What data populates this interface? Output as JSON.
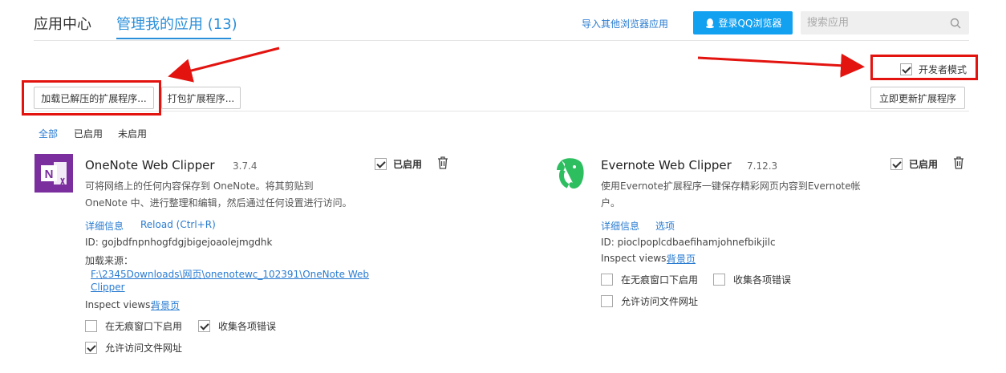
{
  "header": {
    "tab_app_center": "应用中心",
    "tab_manage": "管理我的应用 (13)",
    "import_link": "导入其他浏览器应用",
    "login_button": "登录QQ浏览器",
    "search_placeholder": "搜索应用"
  },
  "toolbar": {
    "load_unpacked": "加载已解压的扩展程序...",
    "pack_extension": "打包扩展程序...",
    "developer_mode_label": "开发者模式",
    "developer_mode_checked": true,
    "update_now": "立即更新扩展程序"
  },
  "filters": [
    "全部",
    "已启用",
    "未启用"
  ],
  "extensions": [
    {
      "name": "OneNote Web Clipper",
      "version": "3.7.4",
      "enabled_label": "已启用",
      "description_line1": "可将网络上的任何内容保存到 OneNote。将其剪贴到",
      "description_line2": "OneNote 中、进行整理和编辑，然后通过任何设置进行访问。",
      "link1": "详细信息",
      "link2": "Reload (Ctrl+R)",
      "id_line": "ID: gojbdfnpnhogfdgjbigejoaolejmgdhk",
      "load_source_label": "加载来源：",
      "load_source_path_line1": "F:\\2345Downloads\\网页\\onenotewc_102391\\OneNote Web",
      "load_source_path_line2": "Clipper",
      "inspect_label": "Inspect views:",
      "inspect_link": "背景页",
      "opt_incognito": "在无痕窗口下启用",
      "opt_errors": "收集各项错误",
      "opt_file_access": "允许访问文件网址"
    },
    {
      "name": "Evernote Web Clipper",
      "version": "7.12.3",
      "enabled_label": "已启用",
      "description_line1": "使用Evernote扩展程序一键保存精彩网页内容到Evernote帐",
      "description_line2": "户。",
      "link1": "详细信息",
      "link2": "选项",
      "id_line": "ID: pioclpoplcdbaefihamjohnefbikjilc",
      "inspect_label": "Inspect views:",
      "inspect_link": "背景页",
      "opt_incognito": "在无痕窗口下启用",
      "opt_errors": "收集各项错误",
      "opt_file_access": "允许访问文件网址"
    }
  ],
  "icons": {
    "search": "search-icon",
    "qq": "qq-penguin-icon",
    "trash": "trash-icon",
    "onenote": "onenote-logo-icon",
    "evernote": "evernote-logo-icon"
  },
  "colors": {
    "accent": "#2a8fd9",
    "login_button": "#12a0f0",
    "annotation_red": "#e3130f",
    "onenote_purple": "#7b2f9e",
    "evernote_green": "#2dbe60"
  }
}
